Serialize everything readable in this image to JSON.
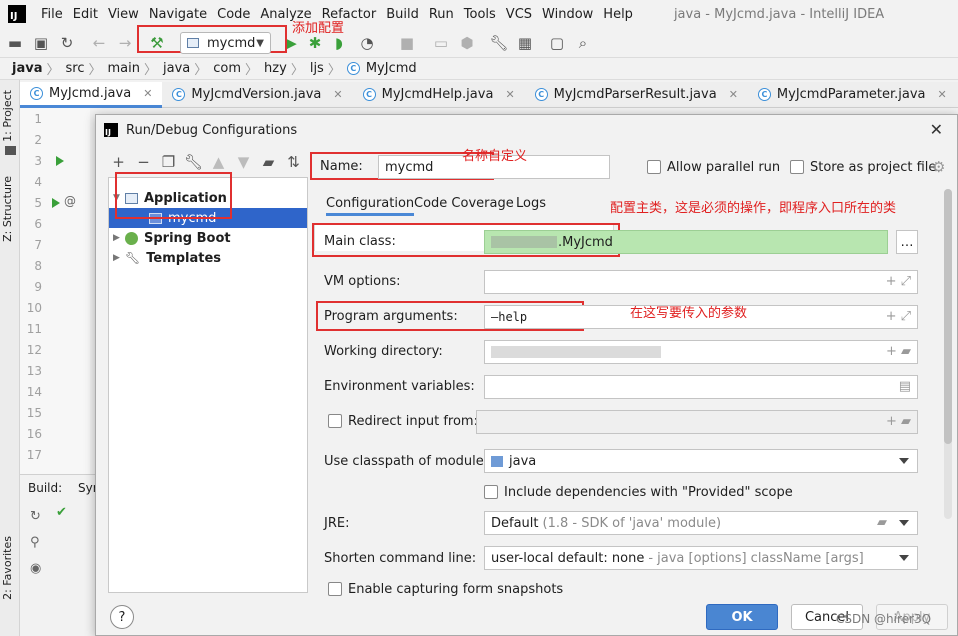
{
  "menubar": {
    "items": [
      "File",
      "Edit",
      "View",
      "Navigate",
      "Code",
      "Analyze",
      "Refactor",
      "Build",
      "Run",
      "Tools",
      "VCS",
      "Window",
      "Help"
    ],
    "title": "java - MyJcmd.java - IntelliJ IDEA"
  },
  "toolbar": {
    "run_config": "mycmd",
    "annotation_add_config": "添加配置"
  },
  "breadcrumbs": [
    "java",
    "src",
    "main",
    "java",
    "com",
    "hzy",
    "ljs",
    "MyJcmd"
  ],
  "tabs": [
    {
      "label": "MyJcmd.java",
      "active": true
    },
    {
      "label": "MyJcmdVersion.java",
      "active": false
    },
    {
      "label": "MyJcmdHelp.java",
      "active": false
    },
    {
      "label": "MyJcmdParserResult.java",
      "active": false
    },
    {
      "label": "MyJcmdParameter.java",
      "active": false
    }
  ],
  "side_tabs": {
    "project": "1: Project",
    "structure": "Z: Structure",
    "favorites": "2: Favorites"
  },
  "gutter_lines": [
    "1",
    "2",
    "3",
    "4",
    "5",
    "6",
    "7",
    "8",
    "9",
    "10",
    "11",
    "12",
    "13",
    "14",
    "15",
    "16",
    "17"
  ],
  "build_panel": {
    "tab": "Build:",
    "tab2": "Syn"
  },
  "dialog": {
    "title": "Run/Debug Configurations",
    "tree": {
      "application": "Application",
      "mycmd": "mycmd",
      "spring_boot": "Spring Boot",
      "templates": "Templates"
    },
    "name_label": "Name:",
    "name_value": "mycmd",
    "annotation_name": "名称自定义",
    "allow_parallel": "Allow parallel run",
    "store_as_project": "Store as project file",
    "subtabs": [
      "Configuration",
      "Code Coverage",
      "Logs"
    ],
    "annotation_main_class": "配置主类，这是必须的操作，即程序入口所在的类",
    "main_class_label": "Main class:",
    "main_class_value": ".MyJcmd",
    "vm_options_label": "VM options:",
    "program_args_label": "Program arguments:",
    "program_args_value": "—help",
    "annotation_args": "在这写要传入的参数",
    "working_dir_label": "Working directory:",
    "env_vars_label": "Environment variables:",
    "redirect_label": "Redirect input from:",
    "classpath_label": "Use classpath of module:",
    "classpath_value": "java",
    "include_deps": "Include dependencies with \"Provided\" scope",
    "jre_label": "JRE:",
    "jre_value": "Default",
    "jre_hint": "(1.8 - SDK of 'java' module)",
    "shorten_label": "Shorten command line:",
    "shorten_value": "user-local default: none",
    "shorten_hint": "- java [options] className [args]",
    "capture_label": "Enable capturing form snapshots",
    "ok": "OK",
    "cancel": "Cancel",
    "apply": "Apply"
  },
  "watermark": "CSDN @hirer3Q"
}
